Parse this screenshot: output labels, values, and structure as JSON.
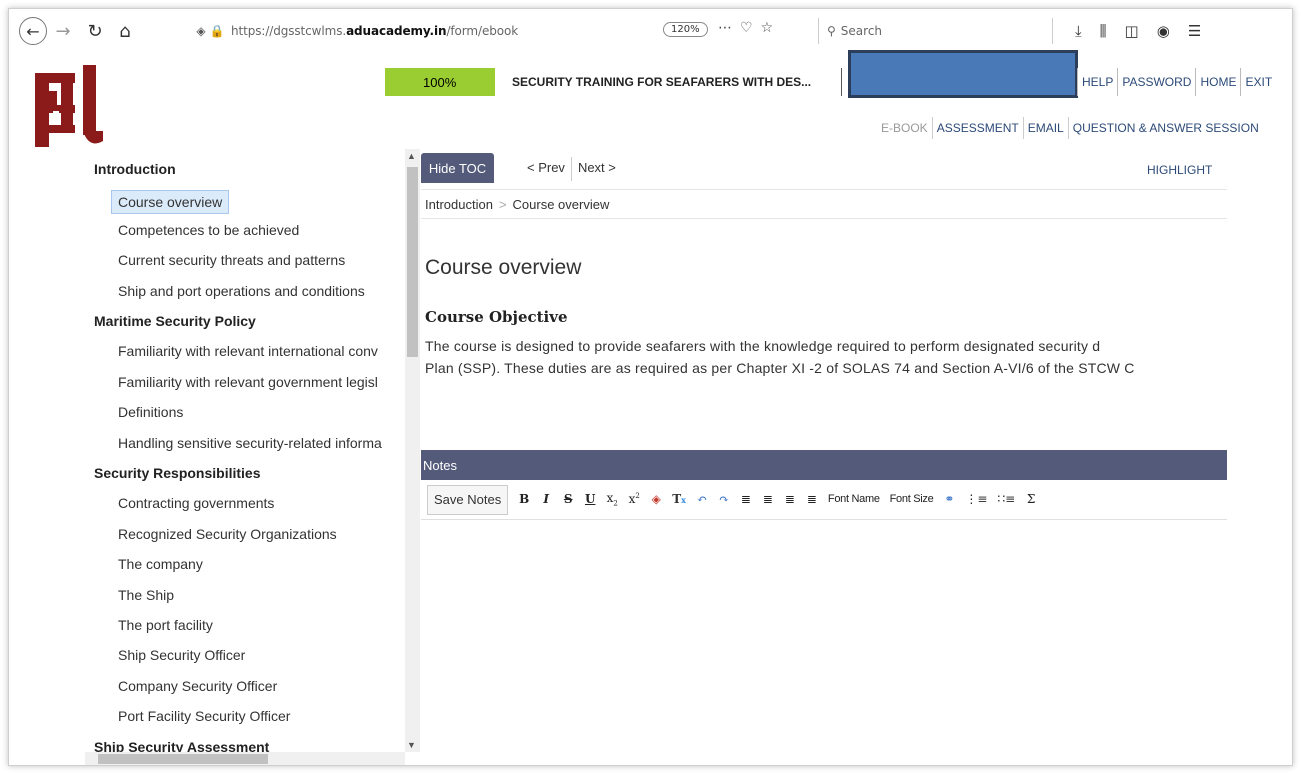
{
  "browser": {
    "url_prefix": "https://dgsstcwlms.",
    "url_domain": "aduacademy.in",
    "url_path": "/form/ebook",
    "zoom": "120%",
    "search_placeholder": "Search"
  },
  "header": {
    "progress": "100%",
    "course_title": "SECURITY TRAINING FOR SEAFARERS WITH DES...",
    "top_nav": [
      "HELP",
      "PASSWORD",
      "HOME",
      "EXIT"
    ],
    "sub_nav": [
      "E-BOOK",
      "ASSESSMENT",
      "EMAIL",
      "QUESTION & ANSWER SESSION"
    ]
  },
  "toc": {
    "items": [
      {
        "label": "Introduction",
        "kind": "section"
      },
      {
        "label": "Course overview",
        "kind": "sub",
        "active": true
      },
      {
        "label": "Competences to be achieved",
        "kind": "sub"
      },
      {
        "label": "Current security threats and patterns",
        "kind": "sub"
      },
      {
        "label": "Ship and port operations and conditions",
        "kind": "sub"
      },
      {
        "label": "Maritime Security Policy",
        "kind": "section"
      },
      {
        "label": "Familiarity with relevant international conv",
        "kind": "sub"
      },
      {
        "label": "Familiarity with relevant government legisl",
        "kind": "sub"
      },
      {
        "label": "Definitions",
        "kind": "sub"
      },
      {
        "label": "Handling sensitive security-related informa",
        "kind": "sub"
      },
      {
        "label": "Security Responsibilities",
        "kind": "section"
      },
      {
        "label": "Contracting governments",
        "kind": "sub"
      },
      {
        "label": "Recognized Security Organizations",
        "kind": "sub"
      },
      {
        "label": "The company",
        "kind": "sub"
      },
      {
        "label": "The Ship",
        "kind": "sub"
      },
      {
        "label": "The port facility",
        "kind": "sub"
      },
      {
        "label": "Ship Security Officer",
        "kind": "sub"
      },
      {
        "label": "Company Security Officer",
        "kind": "sub"
      },
      {
        "label": "Port Facility Security Officer",
        "kind": "sub"
      },
      {
        "label": "Ship Security Assessment",
        "kind": "section"
      }
    ]
  },
  "content": {
    "hide_toc": "Hide TOC",
    "prev": "< Prev",
    "next": "Next >",
    "highlight": "HIGHLIGHT",
    "breadcrumb": [
      "Introduction",
      "Course overview"
    ],
    "title": "Course overview",
    "objective_heading": "Course Objective",
    "body_lines": [
      "The course is designed to provide seafarers with the knowledge required to perform designated security d",
      "Plan (SSP). These duties are as required as per Chapter XI -2 of SOLAS 74 and Section A-VI/6 of the STCW C"
    ]
  },
  "notes": {
    "heading": "Notes",
    "save_label": "Save Notes",
    "font_name": "Font Name",
    "font_size": "Font Size"
  },
  "colors": {
    "panel_header": "#545a7a",
    "progress_green": "#9acd32",
    "logo_maroon": "#8b1a1a",
    "redaction": "#4a79b7"
  }
}
